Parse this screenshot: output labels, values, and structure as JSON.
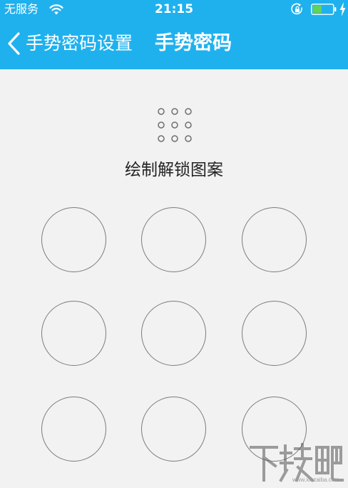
{
  "status_bar": {
    "carrier": "无服务",
    "time": "21:15",
    "battery_level": 0.45,
    "battery_color": "#5fd35a"
  },
  "nav_bar": {
    "back_label": "手势密码设置",
    "title": "手势密码",
    "background": "#1fb1ee"
  },
  "gesture": {
    "prompt": "绘制解锁图案",
    "grid_size": 3,
    "node_count": 9
  },
  "icons": {
    "wifi": "wifi-icon",
    "rotation_lock": "rotation-lock-icon",
    "battery": "battery-icon",
    "charging": "charging-bolt-icon",
    "back": "chevron-left-icon",
    "preview": "pattern-preview-icon"
  },
  "watermark": {
    "text": "下载吧",
    "url_text": "www.xiazaiba.com"
  }
}
